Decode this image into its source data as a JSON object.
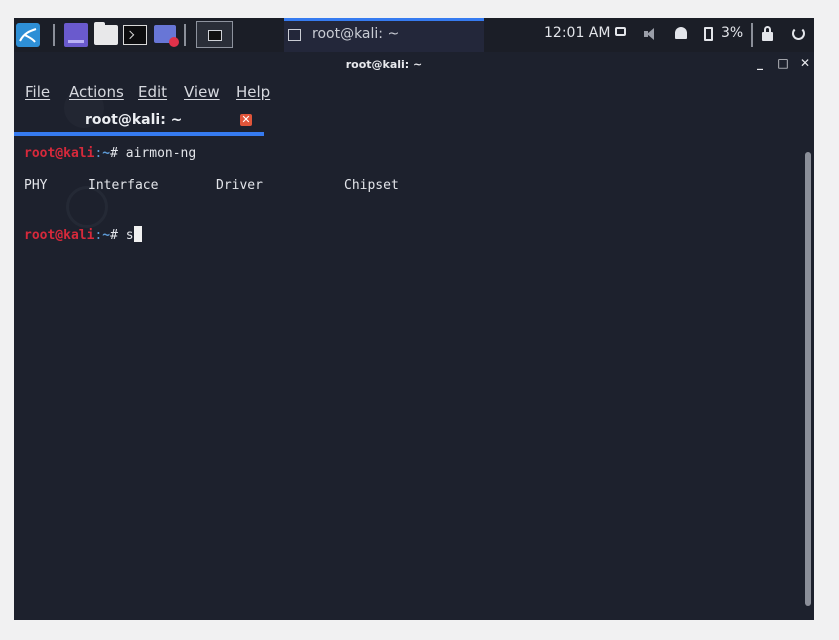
{
  "taskbar": {
    "task_label": "root@kali: ~",
    "clock": "12:01 AM",
    "battery_percent": "3%"
  },
  "window": {
    "title": "root@kali: ~",
    "minimize": "_",
    "maximize": "□",
    "close": "✕"
  },
  "menu": {
    "items": [
      "File",
      "Actions",
      "Edit",
      "View",
      "Help"
    ]
  },
  "tab": {
    "label": "root@kali: ~",
    "close": "✕"
  },
  "terminal": {
    "prompt_user": "root@kali",
    "prompt_colon": ":",
    "prompt_path": "~",
    "prompt_hash": "# ",
    "line1_command": "airmon-ng",
    "headers": [
      "PHY",
      "Interface",
      "Driver",
      "Chipset"
    ],
    "line2_input": "s"
  }
}
